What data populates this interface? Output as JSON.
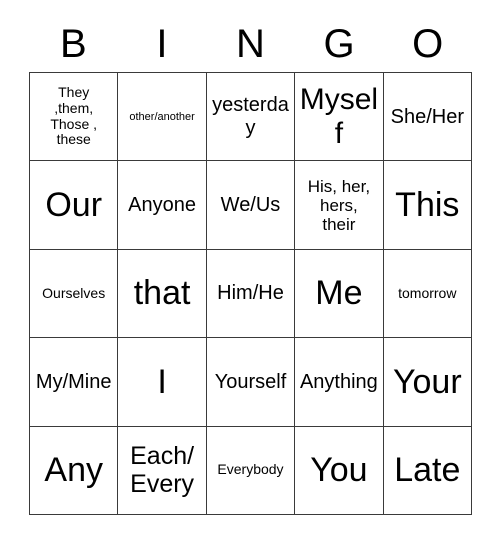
{
  "card": {
    "title": "BINGO",
    "header_letters": [
      "B",
      "I",
      "N",
      "G",
      "O"
    ],
    "grid_line_color": "#3a3a3a",
    "background_color": "#ffffff",
    "text_color": "#000000",
    "rows": 5,
    "columns": 5,
    "cells": [
      [
        {
          "text": "They\n,them,\nThose ,\nthese",
          "size": "xs"
        },
        {
          "text": "other/another",
          "size": "xxs"
        },
        {
          "text": "yesterday",
          "size": "md"
        },
        {
          "text": "Myself",
          "size": "xl"
        },
        {
          "text": "She/Her",
          "size": "md"
        }
      ],
      [
        {
          "text": "Our",
          "size": "xxl"
        },
        {
          "text": "Anyone",
          "size": "md"
        },
        {
          "text": "We/Us",
          "size": "md"
        },
        {
          "text": "His, her,\nhers,\ntheir",
          "size": "sm"
        },
        {
          "text": "This",
          "size": "xxl"
        }
      ],
      [
        {
          "text": "Ourselves",
          "size": "xs"
        },
        {
          "text": "that",
          "size": "xxl"
        },
        {
          "text": "Him/He",
          "size": "md"
        },
        {
          "text": "Me",
          "size": "xxl"
        },
        {
          "text": "tomorrow",
          "size": "xs"
        }
      ],
      [
        {
          "text": "My/Mine",
          "size": "md"
        },
        {
          "text": "I",
          "size": "xxl"
        },
        {
          "text": "Yourself",
          "size": "md"
        },
        {
          "text": "Anything",
          "size": "md"
        },
        {
          "text": "Your",
          "size": "xxl"
        }
      ],
      [
        {
          "text": "Any",
          "size": "xxl"
        },
        {
          "text": "Each/\nEvery",
          "size": "lg"
        },
        {
          "text": "Everybody",
          "size": "xs"
        },
        {
          "text": "You",
          "size": "xxl"
        },
        {
          "text": "Late",
          "size": "xxl"
        }
      ]
    ]
  }
}
